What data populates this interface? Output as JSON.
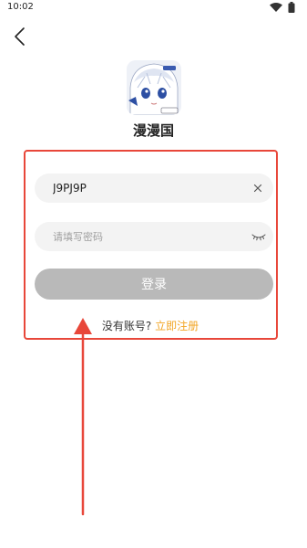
{
  "status_bar": {
    "time": "10:02",
    "icons": [
      "wifi-icon",
      "battery-icon"
    ]
  },
  "nav": {
    "back_icon": "chevron-left-icon"
  },
  "app": {
    "name": "漫漫国",
    "logo": "anime-avatar-logo"
  },
  "login_form": {
    "account_value": "J9PJ9P",
    "clear_icon": "close-icon",
    "password_placeholder": "请填写密码",
    "password_value": "",
    "password_toggle_icon": "eye-closed-icon",
    "login_button_label": "登录",
    "register_question": "没有账号?",
    "register_link": "立即注册"
  },
  "colors": {
    "highlight_border": "#e8473a",
    "register_link": "#f2a524",
    "login_button_disabled": "#b9b9b9",
    "input_background": "#f3f3f3"
  },
  "annotation": {
    "type": "arrow",
    "color": "#e8473a",
    "direction": "up"
  }
}
